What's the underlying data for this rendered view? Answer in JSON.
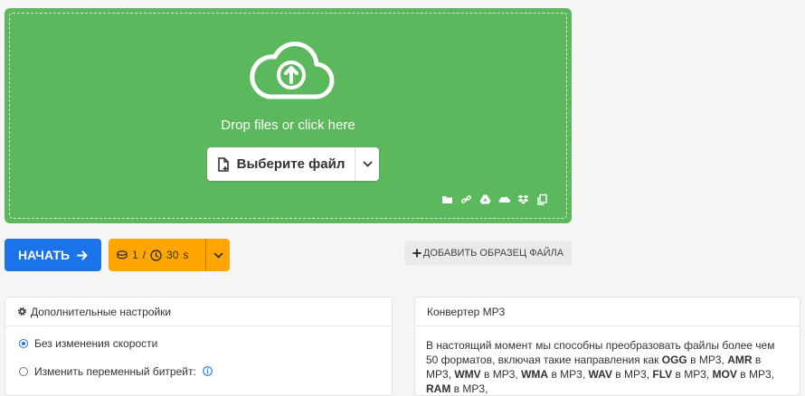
{
  "upload": {
    "drop_text": "Drop files or click here",
    "choose_label": "Выберите файл",
    "sources": [
      "folder-icon",
      "link-icon",
      "google-drive-icon",
      "onedrive-icon",
      "dropbox-icon",
      "clipboard-icon"
    ]
  },
  "actions": {
    "start_label": "НАЧАТЬ",
    "credits_count": "1",
    "credits_separator": "/",
    "credits_time": "30",
    "credits_unit": "s",
    "sample_label": "ДОБАВИТЬ ОБРАЗЕЦ ФАЙЛА"
  },
  "settings": {
    "title": "Дополнительные настройки",
    "options": [
      {
        "label": "Без изменения скорости",
        "checked": true
      },
      {
        "label": "Изменить переменный битрейт:",
        "checked": false
      }
    ]
  },
  "info": {
    "title": "Конвертер MP3",
    "intro": "В настоящий момент мы способны преобразовать файлы более чем 50 форматов, включая такие направления как",
    "pairs": [
      "OGG",
      "AMR",
      "WMV",
      "WMA",
      "WAV",
      "FLV",
      "MOV",
      "RAM"
    ],
    "to_word": "в MP3"
  },
  "colors": {
    "upload_bg": "#5cb85c",
    "primary": "#1a73e8",
    "credits_bg": "#ffa500"
  }
}
